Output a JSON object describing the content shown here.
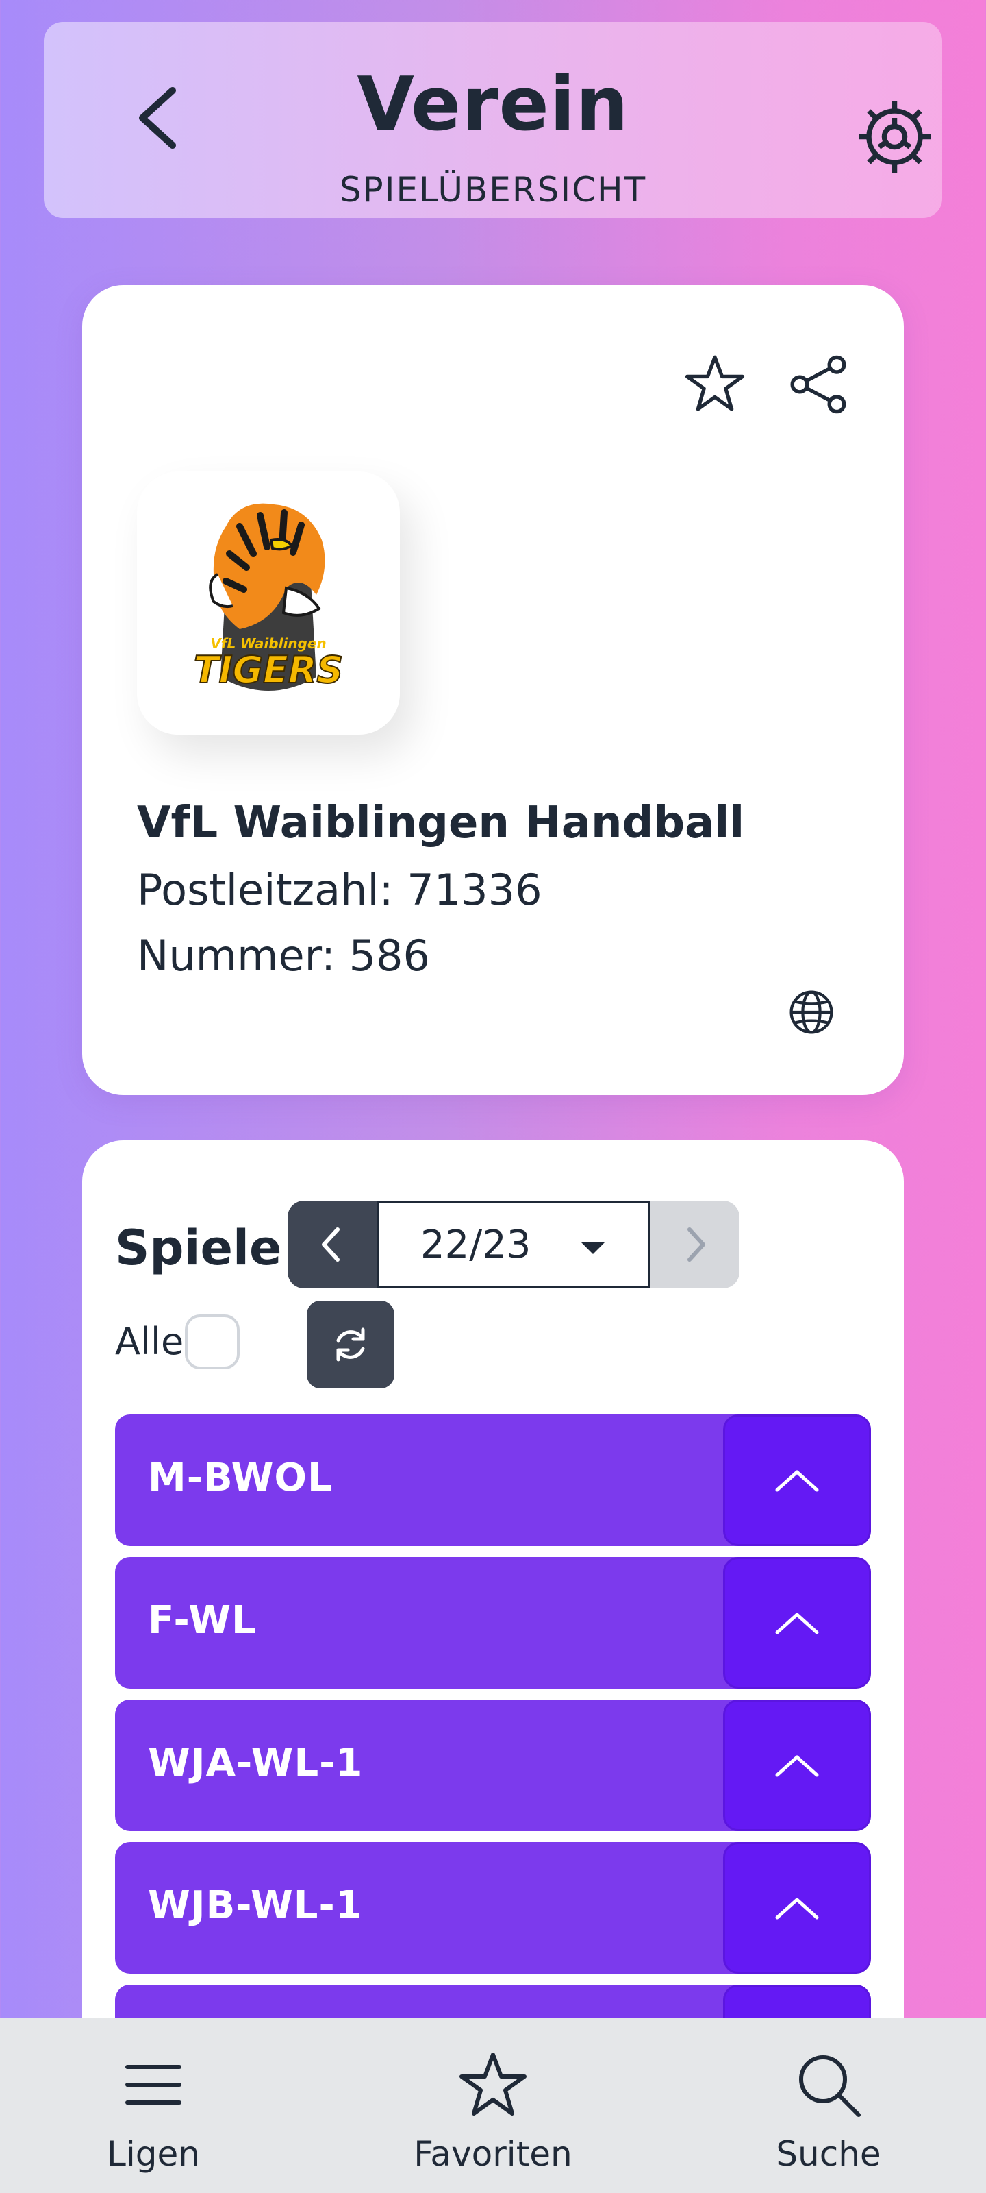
{
  "header": {
    "title": "Verein",
    "subtitle": "SPIELÜBERSICHT",
    "back_icon": "chevron-left-icon",
    "settings_icon": "gear-icon"
  },
  "club": {
    "name": "VfL Waiblingen Handball",
    "postal": "Postleitzahl: 71336",
    "number": "Nummer: 586",
    "logo_text_top": "VfL Waiblingen",
    "logo_text_bottom": "TIGERS"
  },
  "games": {
    "title": "Spiele",
    "season": "22/23",
    "all_label": "Alle",
    "leagues": [
      {
        "label": "M-BWOL"
      },
      {
        "label": "F-WL"
      },
      {
        "label": "WJA-WL-1"
      },
      {
        "label": "WJB-WL-1"
      },
      {
        "label": ""
      }
    ]
  },
  "nav": {
    "items": [
      {
        "label": "Ligen",
        "icon": "menu-icon"
      },
      {
        "label": "Favoriten",
        "icon": "star-icon"
      },
      {
        "label": "Suche",
        "icon": "search-icon"
      }
    ]
  },
  "colors": {
    "accent": "#7c3aed",
    "accent_dark": "#6419f4",
    "dark_button": "#3f4654",
    "text": "#1f2937"
  }
}
